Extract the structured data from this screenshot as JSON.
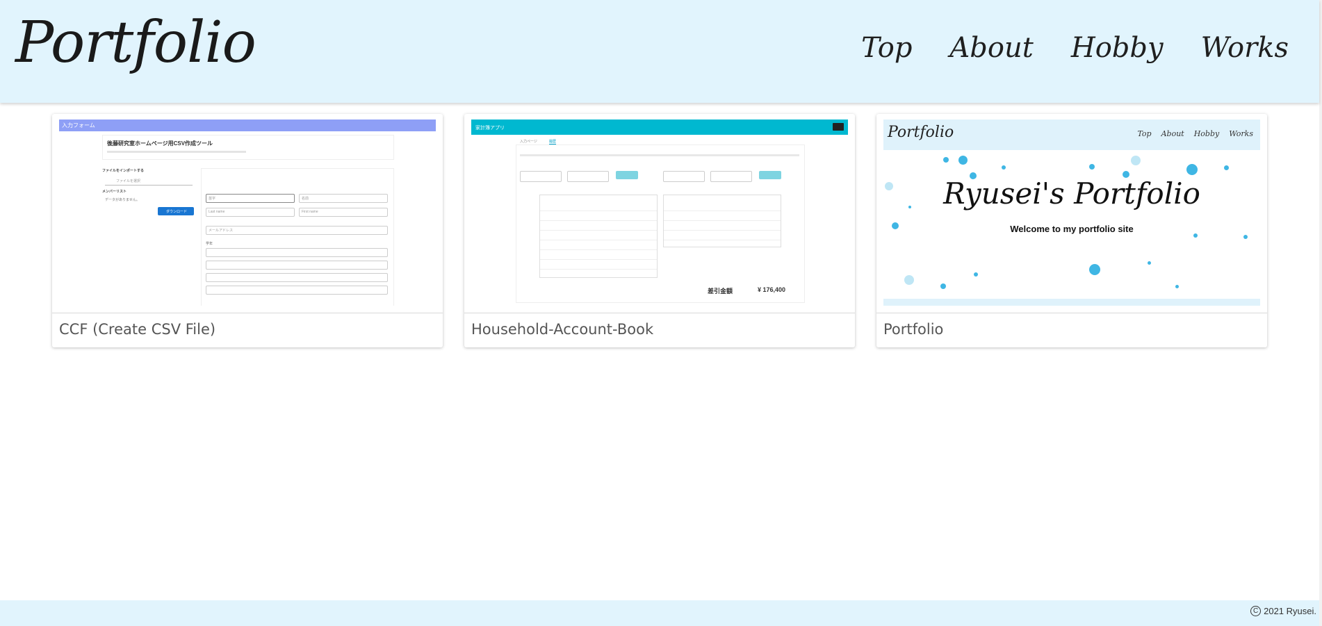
{
  "header": {
    "logo": "Portfolio",
    "nav": [
      "Top",
      "About",
      "Hobby",
      "Works"
    ]
  },
  "cards": [
    {
      "title": "CCF (Create CSV File)",
      "thumb": {
        "bar": "入力フォーム",
        "heading": "後藤研究室ホームページ用CSV作成ツール",
        "file_label": "ファイルをインポートする",
        "file_placeholder": "ファイルを選択",
        "member_list": "メンバーリスト",
        "no_data": "データがありません。",
        "download": "ダウンロード",
        "last_name_ja": "苗字",
        "first_name_ja": "名前",
        "last_name": "Last name",
        "first_name": "First name",
        "email": "メールアドレス",
        "grade": "学年"
      }
    },
    {
      "title": "Household-Account-Book",
      "thumb": {
        "bar": "家計簿アプリ",
        "tab1": "入力ページ",
        "tab2": "履歴",
        "total_label": "差引金額",
        "total_value": "¥ 176,400"
      }
    },
    {
      "title": "Portfolio",
      "thumb": {
        "logo": "Portfolio",
        "nav": [
          "Top",
          "About",
          "Hobby",
          "Works"
        ],
        "hero_title": "Ryusei's Portfolio",
        "welcome": "Welcome to my portfolio site"
      }
    }
  ],
  "footer": {
    "copyright_symbol": "C",
    "copyright": "2021 Ryusei."
  }
}
